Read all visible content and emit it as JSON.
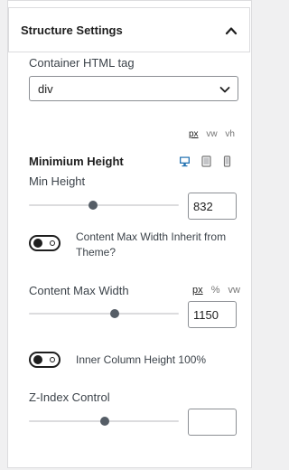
{
  "header": {
    "title": "Structure Settings"
  },
  "container_tag": {
    "label": "Container HTML tag",
    "value": "div"
  },
  "min_height": {
    "units": [
      "px",
      "vw",
      "vh"
    ],
    "active_unit": "px",
    "heading": "Minimium Height",
    "label": "Min Height",
    "value": "832",
    "slider_fraction": 0.42
  },
  "content_width_toggle": {
    "label": "Content Max Width Inherit from Theme?",
    "enabled": false
  },
  "content_max_width": {
    "label": "Content Max Width",
    "units": [
      "px",
      "%",
      "vw"
    ],
    "active_unit": "px",
    "value": "1150",
    "slider_fraction": 0.57
  },
  "inner_column_toggle": {
    "label": "Inner Column Height 100%",
    "enabled": false
  },
  "z_index": {
    "label": "Z-Index Control",
    "value": "",
    "slider_fraction": 0.5
  },
  "colors": {
    "accent": "#2271b1",
    "text": "#1e1e1e",
    "border": "#8c8f94"
  },
  "icons": {
    "collapse": "chevron-up-icon",
    "dropdown": "chevron-down-icon",
    "devices": [
      "desktop-icon",
      "tablet-icon",
      "mobile-icon"
    ]
  }
}
